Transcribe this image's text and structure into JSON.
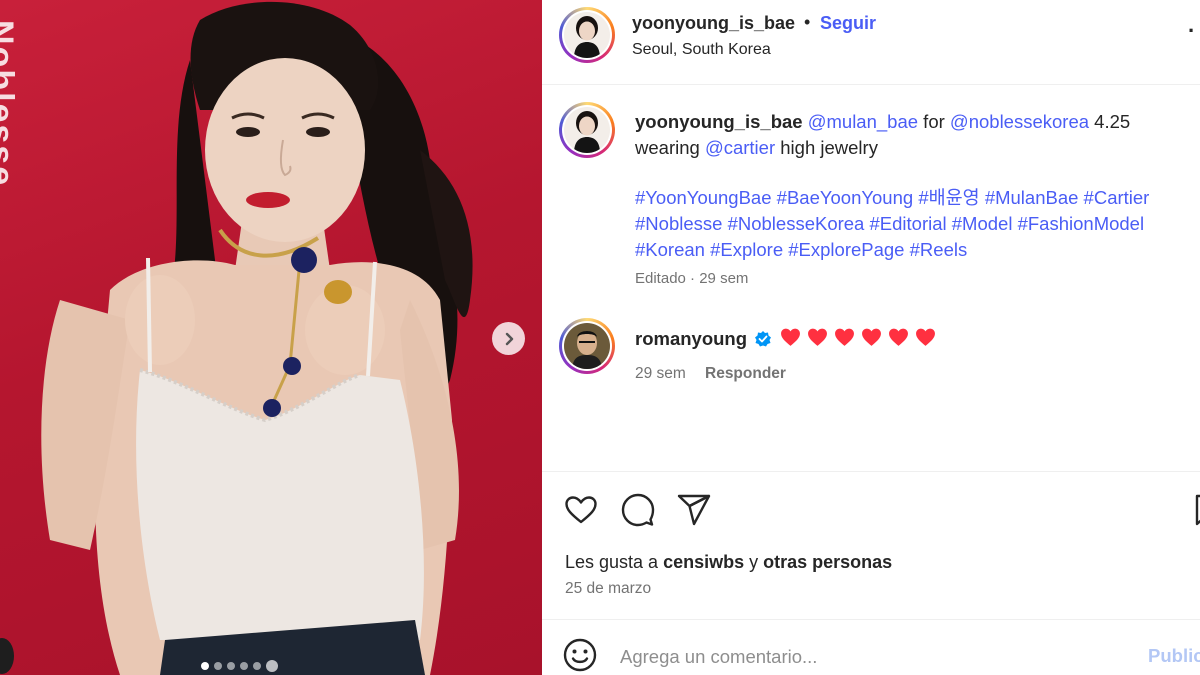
{
  "post": {
    "username": "yoonyoung_is_bae",
    "separator": "•",
    "follow_label": "Seguir",
    "location": "Seoul, South Korea",
    "more_label": "·"
  },
  "caption": {
    "username": "yoonyoung_is_bae",
    "mention_1": "@mulan_bae",
    "text_1": " for ",
    "mention_2": "@noblessekorea",
    "text_2": " 4.25 wearing ",
    "mention_3": "@cartier",
    "text_3": " high jewelry",
    "hashtags": [
      "#YoonYoungBae",
      "#BaeYoonYoung",
      "#배윤영",
      "#MulanBae",
      "#Cartier",
      "#Noblesse",
      "#NoblesseKorea",
      "#Editorial",
      "#Model",
      "#FashionModel",
      "#Korean",
      "#Explore",
      "#ExplorePage",
      "#Reels"
    ],
    "edited": "Editado",
    "meta_sep": " · ",
    "age": "29 sem"
  },
  "comment": {
    "username": "romanyoung",
    "hearts": 6,
    "age": "29 sem",
    "reply_label": "Responder"
  },
  "likes": {
    "prefix": "Les gusta a ",
    "user": "censiwbs",
    "middle": " y ",
    "others": "otras personas"
  },
  "date": "25 de marzo",
  "add_comment": {
    "placeholder": "Agrega un comentario...",
    "post_label": "Publicar"
  },
  "media": {
    "bg_text": "Noblesse",
    "slides": 6,
    "active_slide": 1
  },
  "colors": {
    "accent": "#4a5df5",
    "background_red": "#b5162f",
    "heart": "#ff3040",
    "verified": "#0095f6"
  },
  "icons": {
    "next": "chevron-right-icon",
    "like": "heart-icon",
    "comment": "comment-bubble-icon",
    "share": "paper-plane-icon",
    "save": "bookmark-icon",
    "emoji": "smiley-icon",
    "verified": "verified-badge-icon"
  }
}
